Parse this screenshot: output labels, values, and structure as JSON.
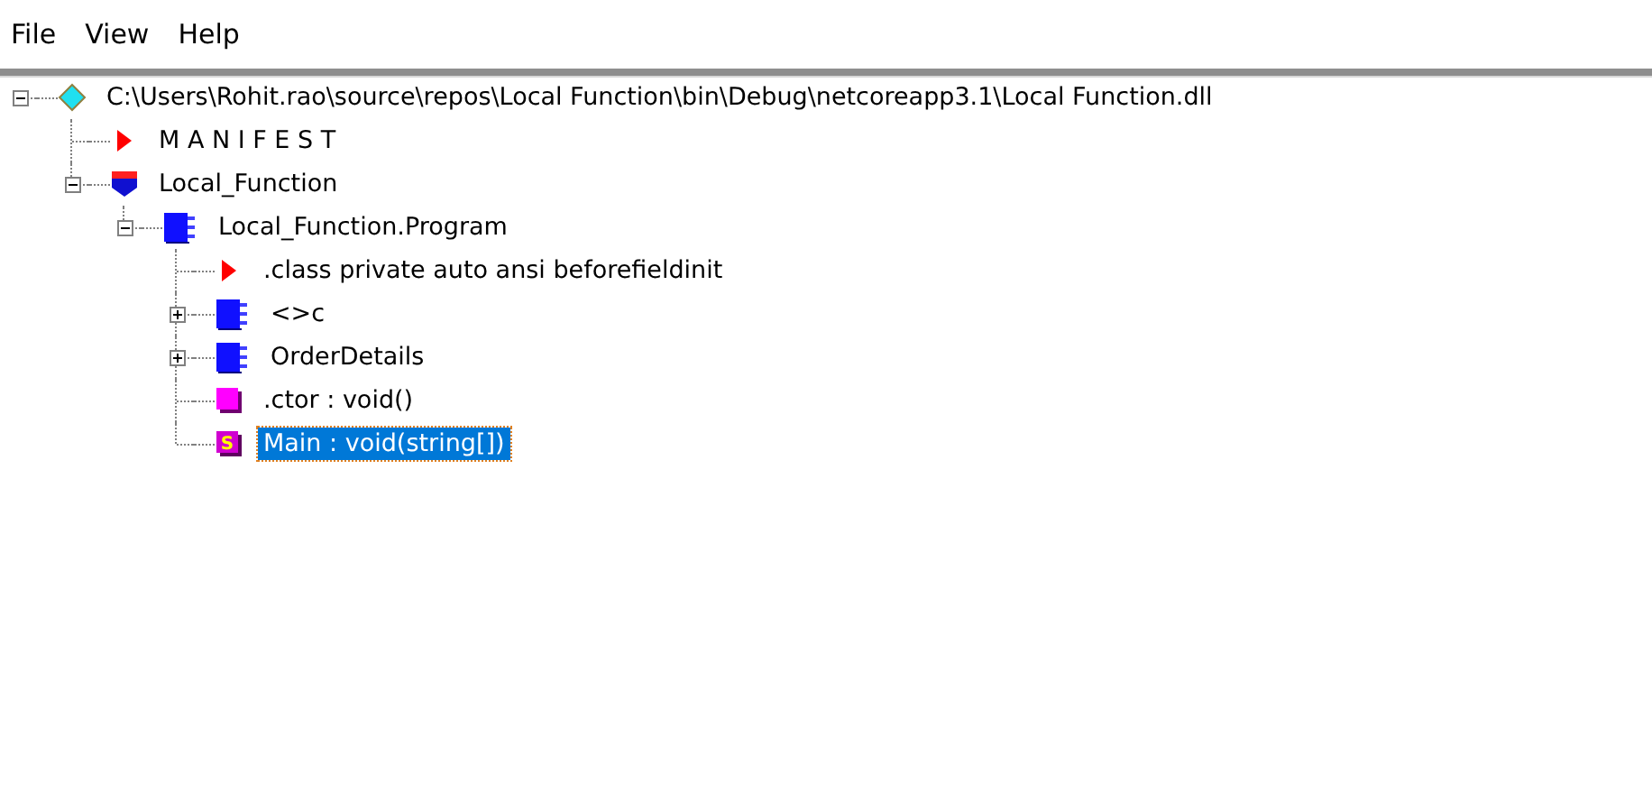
{
  "menu": [
    "File",
    "View",
    "Help"
  ],
  "tree": [
    {
      "kind": "assembly",
      "label": "C:\\Users\\Rohit.rao\\source\\repos\\Local Function\\bin\\Debug\\netcoreapp3.1\\Local Function.dll",
      "expanded": true,
      "selected": false,
      "children": [
        {
          "kind": "manifest",
          "label": "M A N I F E S T",
          "selected": false
        },
        {
          "kind": "namespace",
          "label": "Local_Function",
          "expanded": true,
          "selected": false,
          "children": [
            {
              "kind": "class",
              "label": "Local_Function.Program",
              "expanded": true,
              "selected": false,
              "children": [
                {
                  "kind": "directive",
                  "label": ".class private auto ansi beforefieldinit",
                  "selected": false
                },
                {
                  "kind": "class",
                  "label": "<>c",
                  "expanded": false,
                  "selected": false
                },
                {
                  "kind": "class",
                  "label": "OrderDetails",
                  "expanded": false,
                  "selected": false
                },
                {
                  "kind": "method",
                  "label": ".ctor : void()",
                  "selected": false
                },
                {
                  "kind": "static_method",
                  "icon_text": "S",
                  "label": "Main : void(string[])",
                  "selected": true
                }
              ]
            }
          ]
        }
      ]
    }
  ]
}
